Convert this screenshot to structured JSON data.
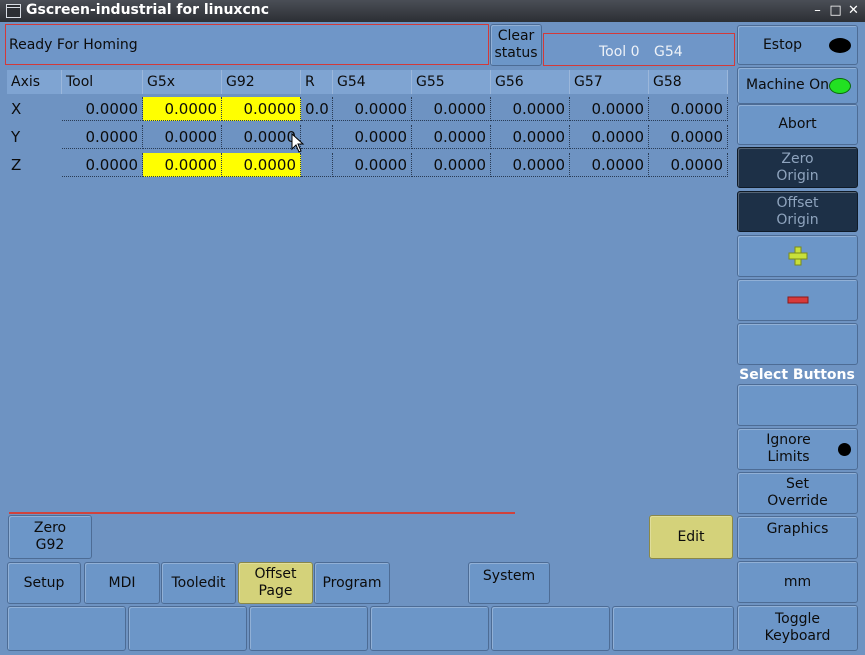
{
  "window": {
    "title": "Gscreen-industrial for linuxcnc"
  },
  "status": {
    "message": "Ready For Homing",
    "clear_label_1": "Clear",
    "clear_label_2": "status",
    "tool_text": "Tool 0",
    "coord_system": "G54"
  },
  "table": {
    "headers": [
      "Axis",
      "Tool",
      "G5x",
      "G92",
      "R",
      "G54",
      "G55",
      "G56",
      "G57",
      "G58"
    ],
    "rows": [
      {
        "axis": "X",
        "tool": "0.0000",
        "g5x": "0.0000",
        "g92": "0.0000",
        "r": "0.0",
        "g54": "0.0000",
        "g55": "0.0000",
        "g56": "0.0000",
        "g57": "0.0000",
        "g58": "0.0000"
      },
      {
        "axis": "Y",
        "tool": "0.0000",
        "g5x": "0.0000",
        "g92": "0.0000",
        "r": "",
        "g54": "0.0000",
        "g55": "0.0000",
        "g56": "0.0000",
        "g57": "0.0000",
        "g58": "0.0000"
      },
      {
        "axis": "Z",
        "tool": "0.0000",
        "g5x": "0.0000",
        "g92": "0.0000",
        "r": "",
        "g54": "0.0000",
        "g55": "0.0000",
        "g56": "0.0000",
        "g57": "0.0000",
        "g58": "0.0000"
      }
    ]
  },
  "right": {
    "estop": "Estop",
    "machine_on": "Machine On",
    "abort": "Abort",
    "zero_origin_1": "Zero",
    "zero_origin_2": "Origin",
    "offset_origin_1": "Offset",
    "offset_origin_2": "Origin",
    "select_buttons": "Select Buttons",
    "ignore_limits_1": "Ignore",
    "ignore_limits_2": "Limits",
    "set_override_1": "Set",
    "set_override_2": "Override",
    "graphics": "Graphics",
    "units": "mm",
    "toggle_keyboard_1": "Toggle",
    "toggle_keyboard_2": "Keyboard"
  },
  "bottom": {
    "zero_g92_1": "Zero",
    "zero_g92_2": "G92",
    "edit": "Edit",
    "setup": "Setup",
    "mdi": "MDI",
    "tooledit": "Tooledit",
    "offset_page_1": "Offset",
    "offset_page_2": "Page",
    "program": "Program",
    "system": "System"
  },
  "colors": {
    "estop_led": "#000000",
    "machine_on_led": "#22e022",
    "highlight": "#ffff00",
    "plus": "#c8e03a",
    "minus": "#d83a3a"
  }
}
